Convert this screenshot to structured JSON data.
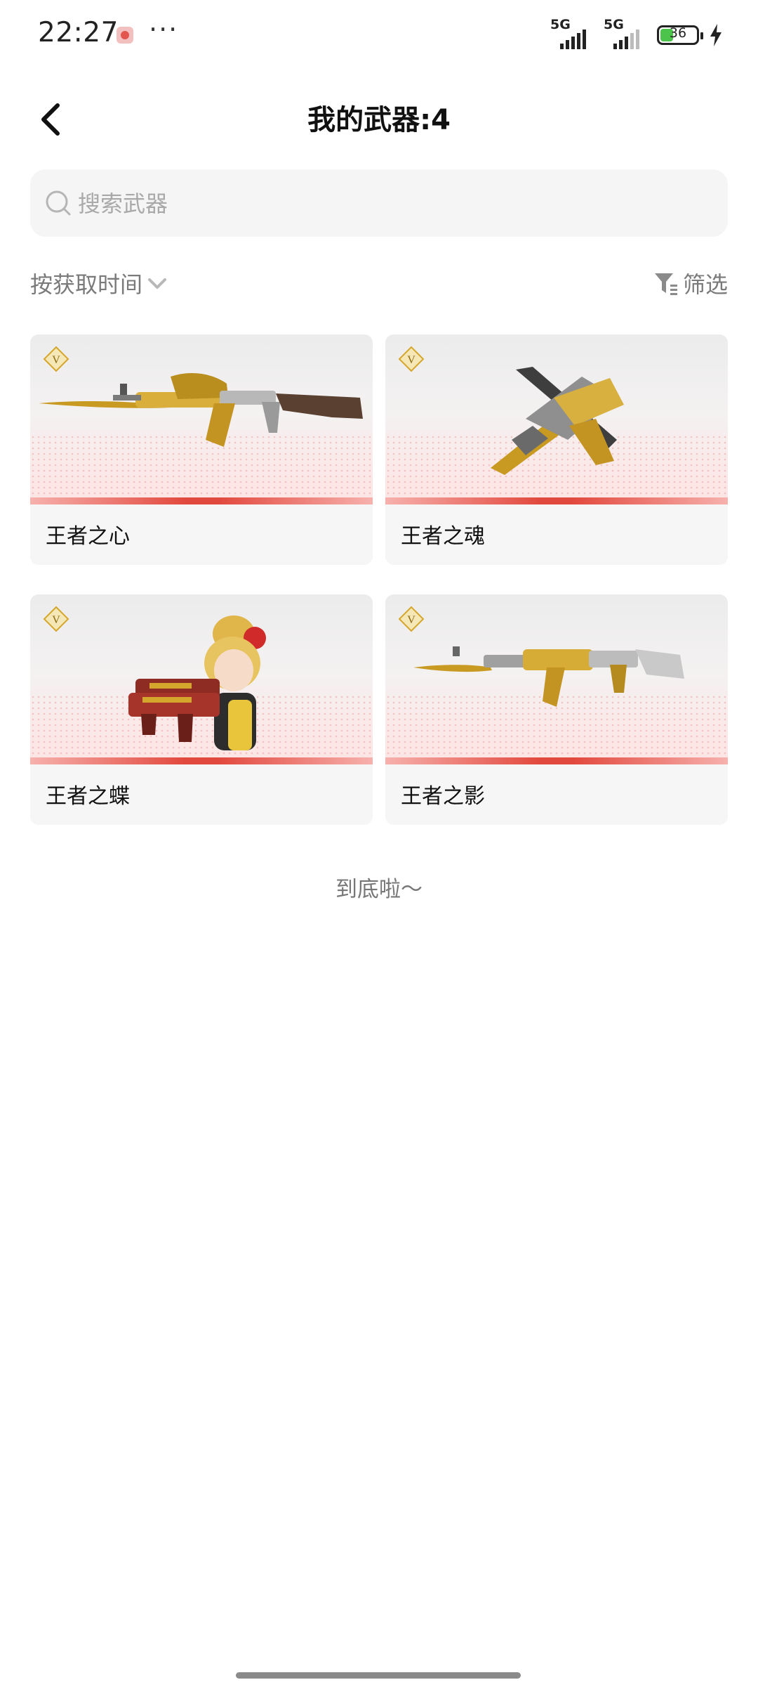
{
  "status_bar": {
    "time": "22:27",
    "more": "···",
    "sim1_label": "5G",
    "sim2_label": "5G",
    "battery_level": "36",
    "battery_percent": 36,
    "battery_color": "#4cc34a"
  },
  "header": {
    "back_icon": "chevron-left-icon",
    "title": "我的武器:4"
  },
  "search": {
    "icon": "search-icon",
    "placeholder": "搜索武器",
    "value": ""
  },
  "sort": {
    "label": "按获取时间",
    "icon": "chevron-down-icon"
  },
  "filter": {
    "icon": "filter-icon",
    "label": "筛选"
  },
  "weapons": [
    {
      "name": "王者之心",
      "badge": "V",
      "art": "golden-rifle-with-blade"
    },
    {
      "name": "王者之魂",
      "badge": "V",
      "art": "golden-pistol-with-blade"
    },
    {
      "name": "王者之蝶",
      "badge": "V",
      "art": "character-with-dual-smgs"
    },
    {
      "name": "王者之影",
      "badge": "V",
      "art": "golden-assault-rifle"
    }
  ],
  "footer": {
    "end_text": "到底啦～"
  },
  "colors": {
    "accent_red": "#e2493e",
    "gold": "#d4a72c",
    "text_gray": "#7a7a7a"
  }
}
